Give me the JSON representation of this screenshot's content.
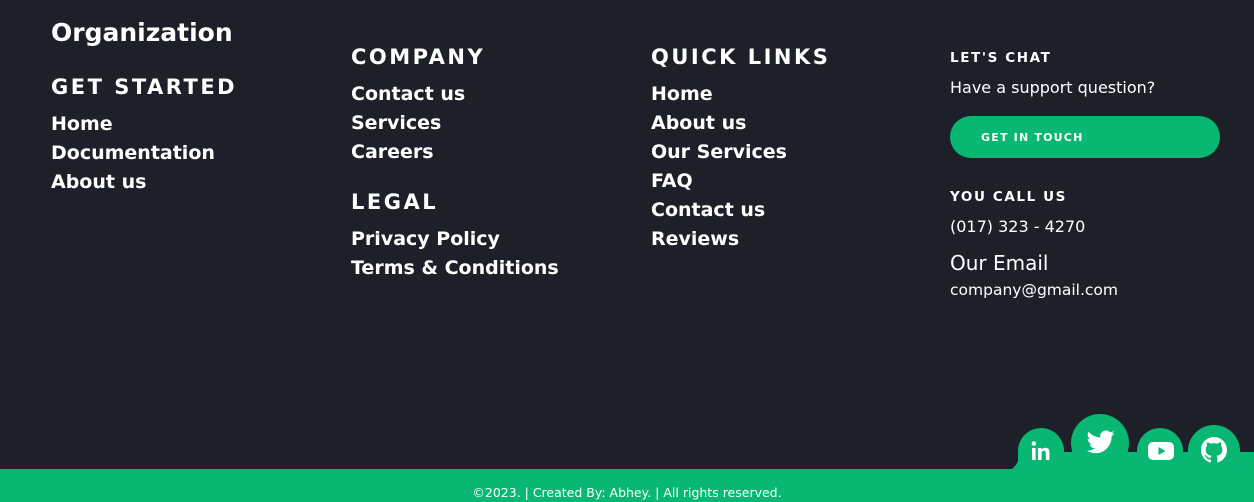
{
  "brand": {
    "title": "Organization"
  },
  "get_started": {
    "heading": "GET STARTED",
    "links": [
      "Home",
      "Documentation",
      "About us"
    ]
  },
  "company": {
    "heading": "COMPANY",
    "links": [
      "Contact us",
      "Services",
      "Careers"
    ]
  },
  "legal": {
    "heading": "LEGAL",
    "links": [
      "Privacy Policy",
      "Terms & Conditions"
    ]
  },
  "quick_links": {
    "heading": "QUICK LINKS",
    "links": [
      "Home",
      "About us",
      "Our Services",
      "FAQ",
      "Contact us",
      "Reviews"
    ]
  },
  "contact": {
    "chat_heading": "LET'S CHAT",
    "chat_text": "Have a support question?",
    "cta_label": "GET IN TOUCH",
    "call_heading": "YOU CALL US",
    "phone": "(017) 323 - 4270",
    "email_heading": "Our Email",
    "email": "company@gmail.com"
  },
  "social": {
    "icons": [
      "linkedin-icon",
      "twitter-icon",
      "youtube-icon",
      "github-icon"
    ]
  },
  "footer": {
    "copyright": "©2023. | Created By: Abhey. | All rights reserved."
  },
  "colors": {
    "background": "#1e2029",
    "accent": "#07b772",
    "text": "#ffffff"
  }
}
